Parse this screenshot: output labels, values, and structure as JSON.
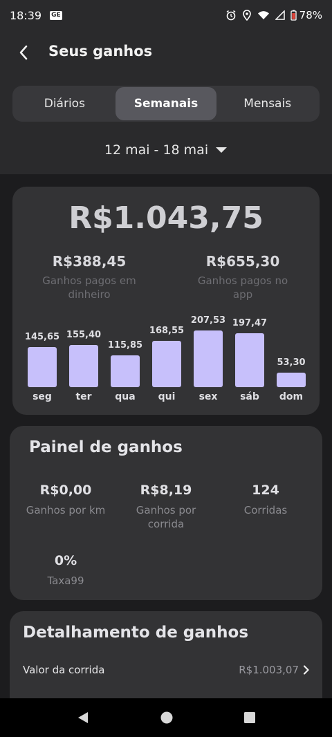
{
  "status_bar": {
    "time": "18:39",
    "battery": "78%"
  },
  "header": {
    "title": "Seus ganhos",
    "tabs": [
      {
        "label": "Diários",
        "active": false
      },
      {
        "label": "Semanais",
        "active": true
      },
      {
        "label": "Mensais",
        "active": false
      }
    ],
    "date_range": "12 mai - 18 mai"
  },
  "summary": {
    "total": "R$1.043,75",
    "cash_value": "R$388,45",
    "cash_label": "Ganhos pagos em dinheiro",
    "app_value": "R$655,30",
    "app_label": "Ganhos pagos no app"
  },
  "chart_data": {
    "type": "bar",
    "categories": [
      "seg",
      "ter",
      "qua",
      "qui",
      "sex",
      "sáb",
      "dom"
    ],
    "values": [
      145.65,
      155.4,
      115.85,
      168.55,
      207.53,
      197.47,
      53.3
    ],
    "value_labels": [
      "145,65",
      "155,40",
      "115,85",
      "168,55",
      "207,53",
      "197,47",
      "53,30"
    ],
    "bar_color": "#c7c0fb"
  },
  "panel": {
    "title": "Painel de ganhos",
    "metrics": [
      {
        "value": "R$0,00",
        "label": "Ganhos por km"
      },
      {
        "value": "R$8,19",
        "label": "Ganhos por corrida"
      },
      {
        "value": "124",
        "label": "Corridas"
      },
      {
        "value": "0%",
        "label": "Taxa99"
      }
    ]
  },
  "detail": {
    "title": "Detalhamento de ganhos",
    "rows": [
      {
        "label": "Valor da corrida",
        "value": "R$1.003,07"
      }
    ]
  },
  "colors": {
    "background": "#1c1c1e",
    "card": "#333335",
    "accent_bar": "#c7c0fb"
  }
}
